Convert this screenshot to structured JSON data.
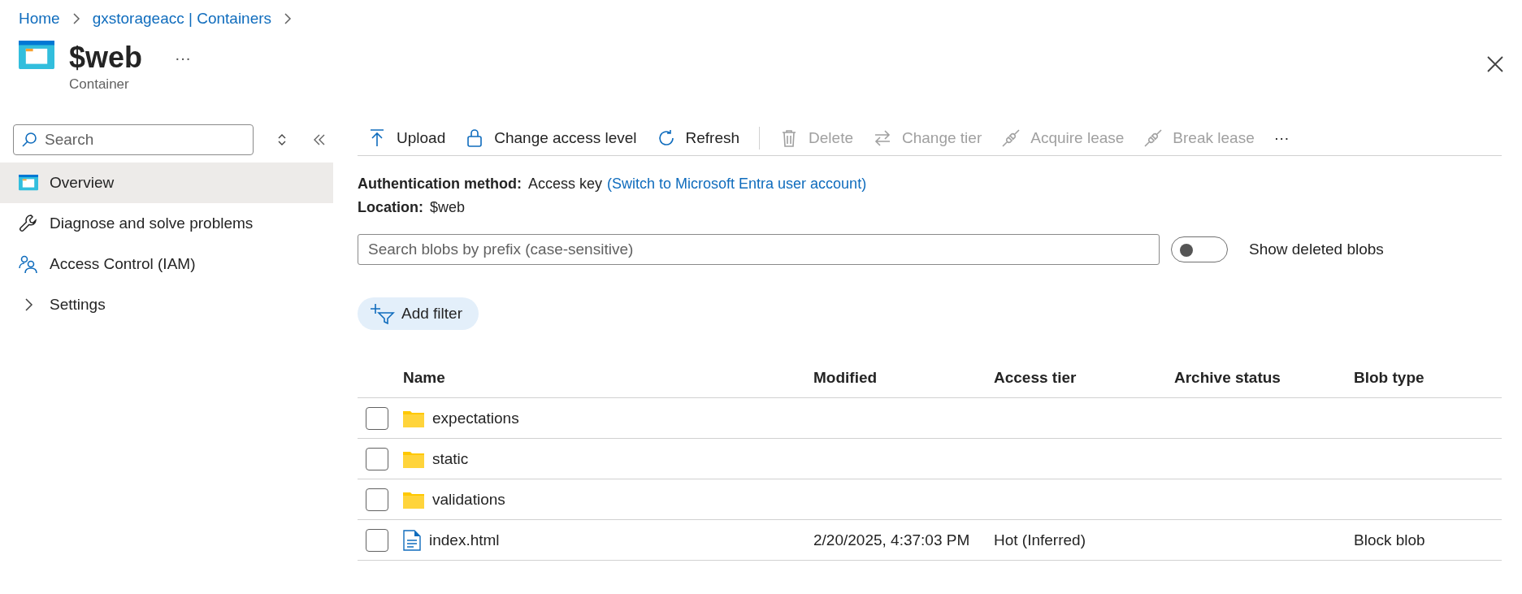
{
  "breadcrumb": [
    "Home",
    "gxstorageacc | Containers"
  ],
  "header": {
    "title": "$web",
    "more": "···",
    "subtitle": "Container"
  },
  "sidebar": {
    "search": {
      "placeholder": "Search"
    },
    "items": [
      {
        "label": "Overview",
        "kind": "container",
        "selected": true
      },
      {
        "label": "Diagnose and solve problems",
        "kind": "wrench",
        "selected": false
      },
      {
        "label": "Access Control (IAM)",
        "kind": "people",
        "selected": false
      },
      {
        "label": "Settings",
        "selected": false,
        "expanded": false
      }
    ]
  },
  "toolbar": [
    {
      "label": "Upload",
      "kind": "upload",
      "disabled": false
    },
    {
      "label": "Change access level",
      "kind": "lock",
      "disabled": false
    },
    {
      "label": "Refresh",
      "kind": "refresh",
      "disabled": false
    },
    {
      "label": "Delete",
      "kind": "trash",
      "disabled": true
    },
    {
      "label": "Change tier",
      "kind": "swap",
      "disabled": true
    },
    {
      "label": "Acquire lease",
      "kind": "plug",
      "disabled": true
    },
    {
      "label": "Break lease",
      "kind": "plug",
      "disabled": true
    }
  ],
  "toolbar_more": "···",
  "auth": {
    "label": "Authentication method:",
    "value": "Access key",
    "link": "(Switch to Microsoft Entra user account)"
  },
  "location": {
    "label": "Location:",
    "value": "$web"
  },
  "blob_search": {
    "placeholder": "Search blobs by prefix (case-sensitive)"
  },
  "show_deleted": {
    "label": "Show deleted blobs",
    "on": false
  },
  "add_filter": "Add filter",
  "table": {
    "columns": [
      "Name",
      "Modified",
      "Access tier",
      "Archive status",
      "Blob type"
    ],
    "rows": [
      {
        "kind": "folder",
        "checked": false,
        "cells": [
          "expectations",
          "",
          "",
          "",
          ""
        ]
      },
      {
        "kind": "folder",
        "checked": false,
        "cells": [
          "static",
          "",
          "",
          "",
          ""
        ]
      },
      {
        "kind": "folder",
        "checked": false,
        "cells": [
          "validations",
          "",
          "",
          "",
          ""
        ]
      },
      {
        "kind": "file",
        "checked": false,
        "cells": [
          "index.html",
          "2/20/2025, 4:37:03 PM",
          "Hot (Inferred)",
          "",
          "Block blob"
        ]
      }
    ]
  }
}
